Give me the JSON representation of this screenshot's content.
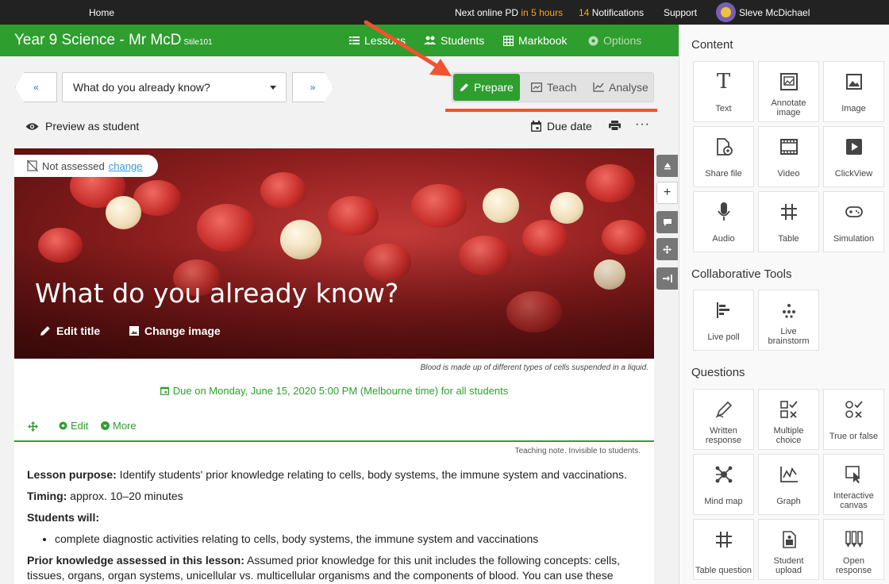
{
  "topbar": {
    "home": "Home",
    "pd_prefix": "Next online PD",
    "pd_time": "in 5 hours",
    "notif_count": "14",
    "notif_label": "Notifications",
    "support": "Support",
    "user_name": "Sleve McDichael"
  },
  "header": {
    "title": "Year 9 Science - Mr McD",
    "class_code": "Stile101",
    "nav": [
      "Lessons",
      "Students",
      "Markbook",
      "Options"
    ]
  },
  "lesson_nav": {
    "prev": "«",
    "next": "»",
    "selected": "What do you already know?"
  },
  "modes": {
    "prepare": "Prepare",
    "teach": "Teach",
    "analyse": "Analyse",
    "active": "Prepare"
  },
  "toolbar": {
    "preview": "Preview as student",
    "due_date": "Due date",
    "more": "···"
  },
  "hero": {
    "assess_status": "Not assessed",
    "assess_link": "change",
    "title": "What do you already know?",
    "edit_title": "Edit title",
    "change_image": "Change image",
    "caption": "Blood is made up of different types of cells suspended in a liquid."
  },
  "due_text": "Due on Monday, June 15, 2020 5:00 PM (Melbourne time) for all students",
  "block_controls": {
    "edit": "Edit",
    "more": "More"
  },
  "teaching_note": "Teaching note. Invisible to students.",
  "content": {
    "purpose_label": "Lesson purpose:",
    "purpose_text": " Identify students' prior knowledge relating to cells, body systems, the immune system and vaccinations.",
    "timing_label": "Timing:",
    "timing_text": " approx. 10–20 minutes",
    "students_will": "Students will:",
    "bullet": "complete diagnostic activities relating to cells, body systems, the immune system and vaccinations",
    "prior_label": "Prior knowledge assessed in this lesson:",
    "prior_text": " Assumed prior knowledge for this unit includes the following concepts: cells, tissues, organs, organ systems, unicellular vs. multicellular organisms and the components of blood. You can use these diagnostic"
  },
  "panel": {
    "content_heading": "Content",
    "content_tiles": [
      "Text",
      "Annotate image",
      "Image",
      "Share file",
      "Video",
      "ClickView",
      "Audio",
      "Table",
      "Simulation"
    ],
    "collab_heading": "Collaborative Tools",
    "collab_tiles": [
      "Live poll",
      "Live brainstorm"
    ],
    "questions_heading": "Questions",
    "question_tiles": [
      "Written response",
      "Multiple choice",
      "True or false",
      "Mind map",
      "Graph",
      "Interactive canvas",
      "Table question",
      "Student upload",
      "Open response"
    ]
  },
  "colors": {
    "brand_green": "#2e9e2e",
    "highlight": "#f5a623",
    "annotation_red": "#f2522e"
  }
}
